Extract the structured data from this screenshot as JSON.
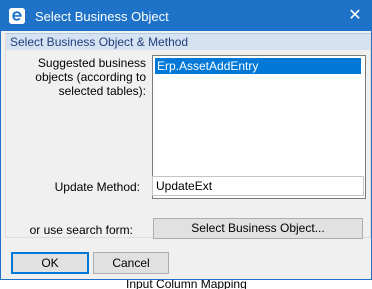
{
  "window": {
    "title": "Select Business Object",
    "close_glyph": "✕",
    "accent_color": "#1e73c9"
  },
  "group": {
    "title": "Select Business Object & Method"
  },
  "suggested": {
    "label": "Suggested business objects (according to selected tables):",
    "items": [
      "Erp.AssetAddEntry"
    ],
    "selected_index": 0
  },
  "update_method": {
    "label": "Update Method:",
    "value": "UpdateExt"
  },
  "search": {
    "label": "or use search form:",
    "button_label": "Select Business Object..."
  },
  "buttons": {
    "ok": "OK",
    "cancel": "Cancel"
  },
  "background": {
    "partial_text": "Input Column Mapping"
  }
}
